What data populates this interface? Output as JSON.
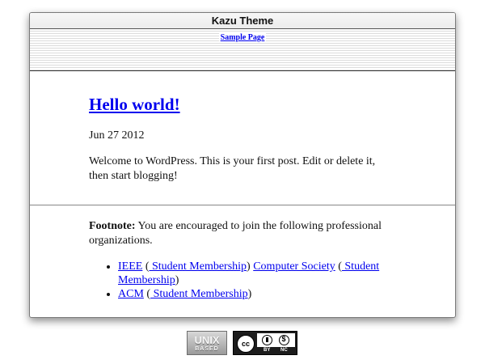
{
  "window": {
    "title": "Kazu Theme"
  },
  "header": {
    "nav_link": "Sample Page"
  },
  "post": {
    "title": "Hello world!",
    "date": "Jun 27 2012",
    "body": "Welcome to WordPress. This is your first post. Edit or delete it, then start blogging!"
  },
  "footnote": {
    "label": "Footnote:",
    "text": " You are encouraged to join the following professional organizations.",
    "orgs": [
      {
        "name": "IEEE",
        "student_label": " Student Membership",
        "society": "Computer Society",
        "society_student_label": " Student Membership"
      },
      {
        "name": "ACM",
        "student_label": " Student Membership"
      }
    ]
  },
  "badges": {
    "unix_big": "UNIX",
    "unix_small": "BASED",
    "cc_symbol": "cc",
    "cc_by": "BY",
    "cc_nc": "NC"
  }
}
